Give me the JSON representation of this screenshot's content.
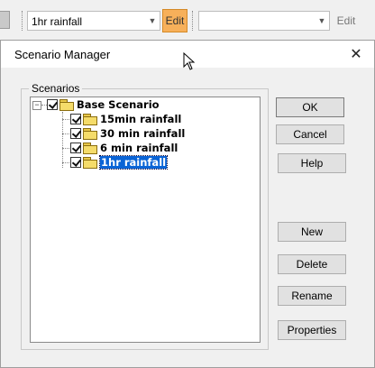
{
  "toolbar": {
    "scenario_combo_value": "1hr rainfall",
    "edit_label": "Edit",
    "second_combo_value": "",
    "edit2_label": "Edit"
  },
  "dialog": {
    "title": "Scenario Manager",
    "group_label": "Scenarios",
    "tree": {
      "root": {
        "label": "Base Scenario",
        "checked": true,
        "expanded": true
      },
      "children": [
        {
          "label": "15min rainfall",
          "checked": true,
          "selected": false
        },
        {
          "label": "30 min rainfall",
          "checked": true,
          "selected": false
        },
        {
          "label": "6 min rainfall",
          "checked": true,
          "selected": false
        },
        {
          "label": "1hr rainfall",
          "checked": true,
          "selected": true
        }
      ]
    },
    "buttons": {
      "ok": "OK",
      "cancel": "Cancel",
      "help": "Help",
      "new": "New",
      "delete": "Delete",
      "rename": "Rename",
      "properties": "Properties"
    }
  },
  "colors": {
    "selection": "#0a64d6",
    "edit_active": "#f7b05a",
    "folder": "#f5dc6a"
  },
  "icons": [
    "toolbar-icon",
    "chevron-down-icon",
    "close-icon",
    "checkbox-icon",
    "folder-icon",
    "folder-open-icon",
    "mouse-pointer-icon"
  ]
}
